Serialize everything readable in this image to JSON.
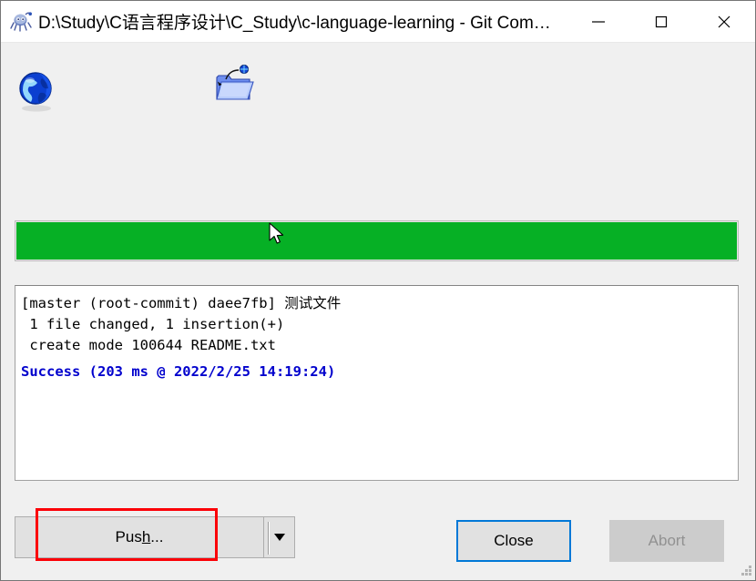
{
  "window": {
    "title": "D:\\Study\\C语言程序设计\\C_Study\\c-language-learning - Git Com…",
    "app_icon": "git-gui-icon",
    "controls": {
      "minimize_label": "—",
      "maximize_label": "▢",
      "close_label": "✕"
    }
  },
  "toolbar": {
    "icons": [
      {
        "name": "globe-icon",
        "label": ""
      },
      {
        "name": "folder-remote-icon",
        "label": ""
      }
    ]
  },
  "progress": {
    "percent": 100,
    "fill_color": "#06b025",
    "track_color": "#e6e6e6"
  },
  "output": {
    "lines": "[master (root-commit) daee7fb] 测试文件\n 1 file changed, 1 insertion(+)\n create mode 100644 README.txt",
    "status_line": "Success (203 ms @ 2022/2/25 14:19:24)",
    "status_color": "#0000cd"
  },
  "buttons": {
    "push": {
      "label_before": "Pus",
      "label_accel": "h",
      "label_after": "...",
      "full_label": "Push...",
      "has_dropdown": true,
      "highlighted": true,
      "highlight_color": "#fb0007"
    },
    "dropdown_arrow": "▼",
    "close": {
      "label": "Close",
      "focused": true,
      "focus_color": "#0078d7"
    },
    "abort": {
      "label": "Abort",
      "disabled": true
    }
  },
  "grip": {
    "name": "resize-grip"
  }
}
